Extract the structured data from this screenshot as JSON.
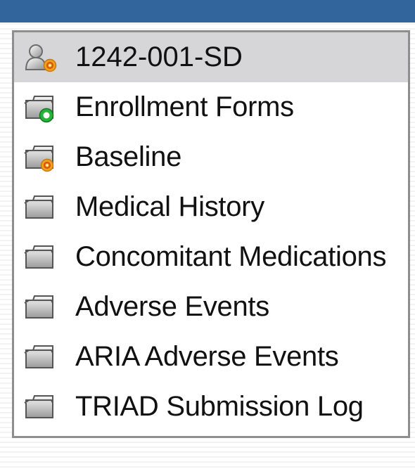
{
  "tree": {
    "items": [
      {
        "label": "1242-001-SD",
        "icon": "user-icon",
        "badge": "orange-status-icon",
        "selected": true
      },
      {
        "label": "Enrollment Forms",
        "icon": "folder-icon",
        "badge": "green-status-icon",
        "selected": false
      },
      {
        "label": "Baseline",
        "icon": "folder-icon",
        "badge": "orange-status-icon",
        "selected": false
      },
      {
        "label": "Medical History",
        "icon": "folder-icon",
        "badge": "",
        "selected": false
      },
      {
        "label": "Concomitant Medications",
        "icon": "folder-icon",
        "badge": "",
        "selected": false
      },
      {
        "label": "Adverse Events",
        "icon": "folder-icon",
        "badge": "",
        "selected": false
      },
      {
        "label": "ARIA Adverse Events",
        "icon": "folder-icon",
        "badge": "",
        "selected": false
      },
      {
        "label": "TRIAD Submission Log",
        "icon": "folder-icon",
        "badge": "",
        "selected": false
      }
    ]
  },
  "colors": {
    "header_bar": "#31659c",
    "selected_row": "#d6d6d8",
    "panel_border": "#8e8e8e",
    "status_green": "#27b23a",
    "status_orange": "#f0a21c"
  }
}
